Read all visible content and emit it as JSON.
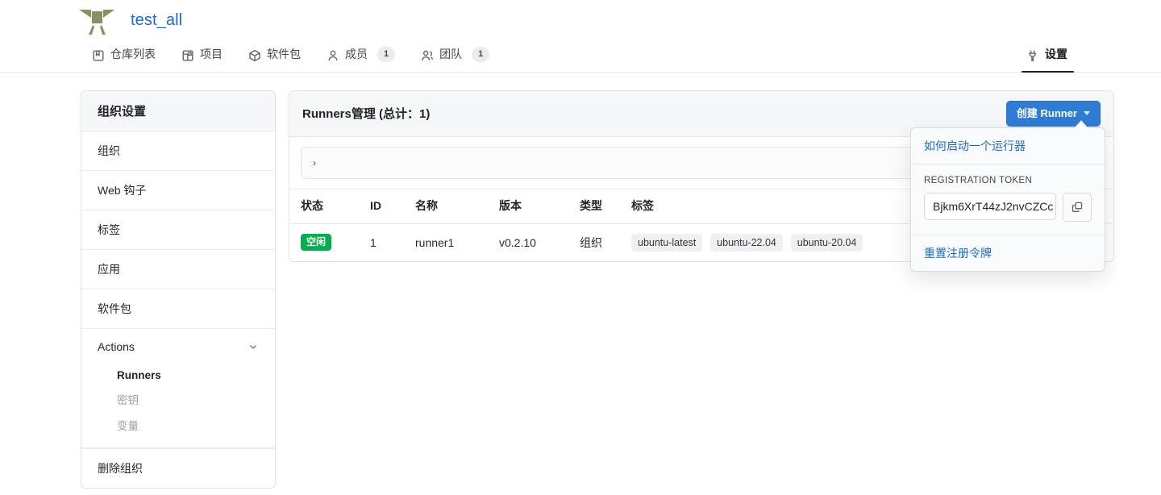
{
  "header": {
    "org_name": "test_all",
    "logo_color": "#8d8f5f",
    "nav": [
      {
        "label": "仓库列表",
        "icon": "repo-icon",
        "count": null,
        "active": false
      },
      {
        "label": "项目",
        "icon": "project-icon",
        "count": null,
        "active": false
      },
      {
        "label": "软件包",
        "icon": "package-icon",
        "count": null,
        "active": false
      },
      {
        "label": "成员",
        "icon": "person-icon",
        "count": "1",
        "active": false
      },
      {
        "label": "团队",
        "icon": "people-icon",
        "count": "1",
        "active": false
      }
    ],
    "nav_right": {
      "label": "设置",
      "icon": "tools-icon",
      "active": true
    }
  },
  "sidebar": {
    "heading": "组织设置",
    "items": [
      {
        "label": "组织"
      },
      {
        "label": "Web 钩子"
      },
      {
        "label": "标签"
      },
      {
        "label": "应用"
      },
      {
        "label": "软件包"
      }
    ],
    "group": {
      "label": "Actions",
      "expanded": true,
      "sub_items": [
        {
          "label": "Runners",
          "current": true
        },
        {
          "label": "密钥",
          "current": false
        },
        {
          "label": "变量",
          "current": false
        }
      ]
    },
    "danger": {
      "label": "删除组织"
    }
  },
  "main": {
    "card_title": "Runners管理 (总计：1)",
    "create_button": "创建 Runner",
    "filter_text": "›",
    "table": {
      "columns": [
        "状态",
        "ID",
        "名称",
        "版本",
        "类型",
        "标签"
      ],
      "rows": [
        {
          "status": "空闲",
          "status_color": "#00af4d",
          "id": "1",
          "name": "runner1",
          "version": "v0.2.10",
          "type": "组织",
          "labels": [
            "ubuntu-latest",
            "ubuntu-22.04",
            "ubuntu-20.04"
          ]
        }
      ]
    }
  },
  "popup": {
    "how_to_link": "如何启动一个运行器",
    "token_label": "REGISTRATION TOKEN",
    "token_value": "Bjkm6XrT44zJ2nvCZCc",
    "copy_icon": "copy-icon",
    "reset_link": "重置注册令牌"
  }
}
